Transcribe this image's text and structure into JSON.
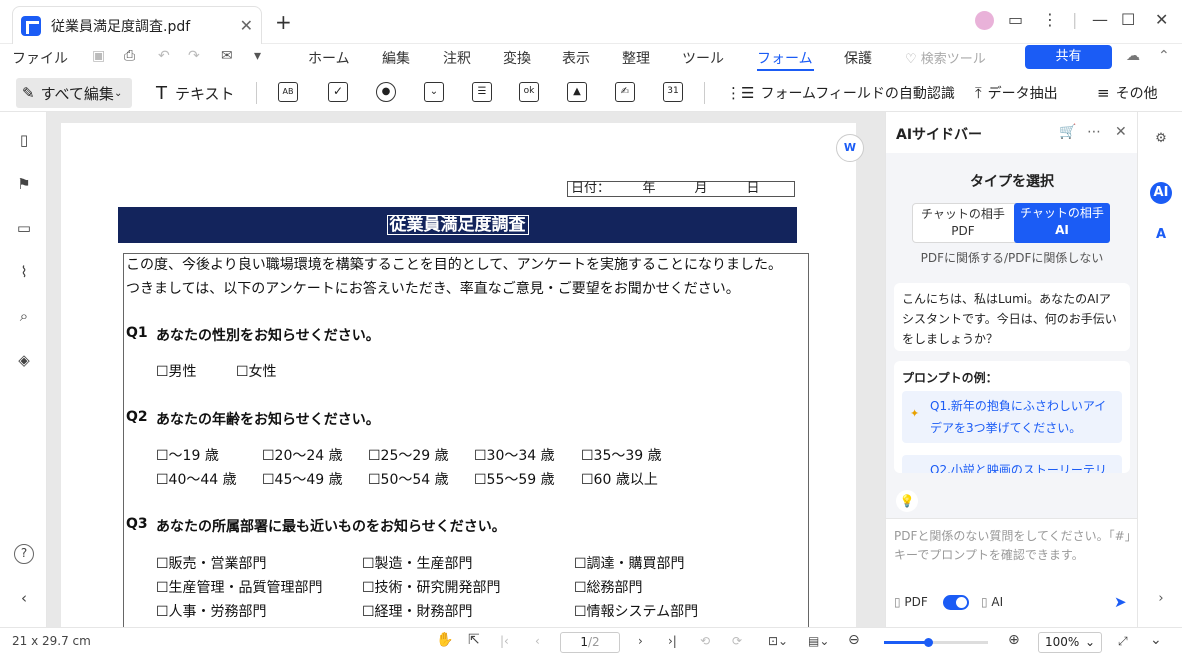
{
  "tab": {
    "title": "従業員満足度調査.pdf"
  },
  "menu": {
    "file": "ファイル",
    "items": [
      "ホーム",
      "編集",
      "注釈",
      "変換",
      "表示",
      "整理",
      "ツール",
      "フォーム",
      "保護"
    ],
    "search_tool": "検索ツール",
    "share": "共有"
  },
  "toolbar": {
    "edit_all": "すべて編集",
    "text": "テキスト",
    "auto_detect": "フォームフィールドの自動認識",
    "extract": "データ抽出",
    "more": "その他"
  },
  "document": {
    "date_line": "日付：　　　年　　　月　　　日",
    "title": "従業員満足度調査",
    "intro1": "この度、今後より良い職場環境を構築することを目的として、アンケートを実施することになりました。",
    "intro2": "つきましては、以下のアンケートにお答えいただき、率直なご意見・ご要望をお聞かせください。",
    "q1": {
      "num": "Q1",
      "text": "あなたの性別をお知らせください。",
      "options": [
        "☐男性",
        "☐女性"
      ]
    },
    "q2": {
      "num": "Q2",
      "text": "あなたの年齢をお知らせください。",
      "options": [
        "☐～19 歳",
        "☐20～24 歳",
        "☐25～29 歳",
        "☐30～34 歳",
        "☐35～39 歳",
        "☐40～44 歳",
        "☐45～49 歳",
        "☐50～54 歳",
        "☐55～59 歳",
        "☐60 歳以上"
      ]
    },
    "q3": {
      "num": "Q3",
      "text": "あなたの所属部署に最も近いものをお知らせください。",
      "options": [
        "☐販売・営業部門",
        "☐製造・生産部門",
        "☐調達・購買部門",
        "☐生産管理・品質管理部門",
        "☐技術・研究開発部門",
        "☐総務部門",
        "☐人事・労務部門",
        "☐経理・財務部門",
        "☐情報システム部門"
      ]
    }
  },
  "ai": {
    "title": "AIサイドバー",
    "select_type": "タイプを選択",
    "opt_pdf_l1": "チャットの相手",
    "opt_pdf_l2": "PDF",
    "opt_ai_l1": "チャットの相手",
    "opt_ai_l2": "AI",
    "note": "PDFに関係する/PDFに関係しない",
    "greeting": "こんにちは、私はLumi。あなたのAIアシスタントです。今日は、何のお手伝いをしましょうか？",
    "prompt_title": "プロンプトの例：",
    "prompt1": "Q1.新年の抱負にふさわしいアイデアを3つ挙げてください。",
    "prompt2": "Q2.小説と映画のストーリーテリ",
    "input_placeholder": "PDFと関係のない質問をしてください。「#」キーでプロンプトを確認できます。",
    "opt_pdf": "PDF",
    "opt_ai": "AI"
  },
  "status": {
    "size": "21 x 29.7 cm",
    "page": "1",
    "page_total": "/2",
    "zoom": "100%",
    "zoom_level": 0.42
  }
}
